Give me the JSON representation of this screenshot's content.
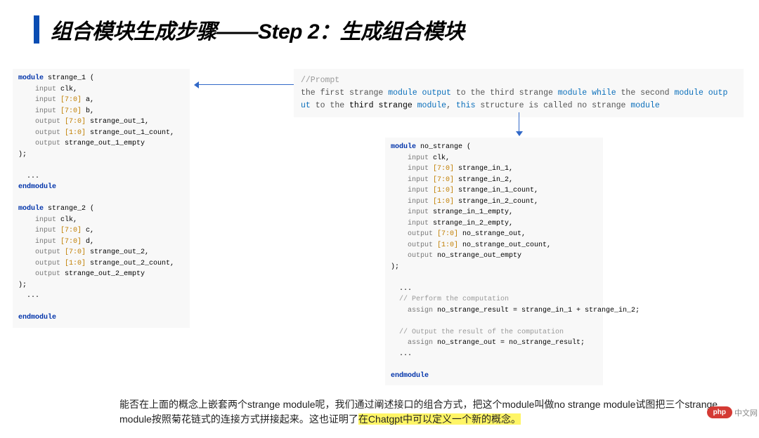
{
  "title": "组合模块生成步骤——Step 2：生成组合模块",
  "left_code": {
    "l1a": "module",
    "l1b": " strange_1 (",
    "l2a": "    input",
    "l2b": " clk,",
    "l3a": "    input ",
    "l3b": "[7:0]",
    "l3c": " a,",
    "l4a": "    input ",
    "l4b": "[7:0]",
    "l4c": " b,",
    "l5a": "    output ",
    "l5b": "[7:0]",
    "l5c": " strange_out_1,",
    "l6a": "    output ",
    "l6b": "[1:0]",
    "l6c": " strange_out_1_count,",
    "l7a": "    output",
    "l7b": " strange_out_1_empty",
    "l8": ");",
    "l9": " ",
    "l10": "  ...",
    "l11": "endmodule",
    "l12": " ",
    "l13a": "module",
    "l13b": " strange_2 (",
    "l14a": "    input",
    "l14b": " clk,",
    "l15a": "    input ",
    "l15b": "[7:0]",
    "l15c": " c,",
    "l16a": "    input ",
    "l16b": "[7:0]",
    "l16c": " d,",
    "l17a": "    output ",
    "l17b": "[7:0]",
    "l17c": " strange_out_2,",
    "l18a": "    output ",
    "l18b": "[1:0]",
    "l18c": " strange_out_2_count,",
    "l19a": "    output",
    "l19b": " strange_out_2_empty",
    "l20": ");",
    "l21": "  ...",
    "l22": " ",
    "l23": "endmodule"
  },
  "prompt": {
    "c": "//Prompt",
    "p1a": "the first strange ",
    "p1b": "module output",
    "p1c": " to the third strange ",
    "p1d": "module while",
    "p1e": " the second ",
    "p1f": "module outp",
    "p2a": "ut",
    "p2b": " to the ",
    "p2c": "third strange",
    "p2d": " module",
    "p2e": ", ",
    "p2f": "this",
    "p2g": " structure is called no strange ",
    "p2h": "module"
  },
  "right_code": {
    "l1a": "module",
    "l1b": " no_strange (",
    "l2a": "    input",
    "l2b": " clk,",
    "l3a": "    input ",
    "l3b": "[7:0]",
    "l3c": " strange_in_1,",
    "l4a": "    input ",
    "l4b": "[7:0]",
    "l4c": " strange_in_2,",
    "l5a": "    input ",
    "l5b": "[1:0]",
    "l5c": " strange_in_1_count,",
    "l6a": "    input ",
    "l6b": "[1:0]",
    "l6c": " strange_in_2_count,",
    "l7a": "    input",
    "l7b": " strange_in_1_empty,",
    "l8a": "    input",
    "l8b": " strange_in_2_empty,",
    "l9a": "    output ",
    "l9b": "[7:0]",
    "l9c": " no_strange_out,",
    "l10a": "    output ",
    "l10b": "[1:0]",
    "l10c": " no_strange_out_count,",
    "l11a": "    output",
    "l11b": " no_strange_out_empty",
    "l12": ");",
    "l13": " ",
    "l14": "  ...",
    "l15": "  // Perform the computation",
    "l16a": "    assign",
    "l16b": " no_strange_result = strange_in_1 + strange_in_2;",
    "l17": " ",
    "l18": "  // Output the result of the computation",
    "l19a": "    assign",
    "l19b": " no_strange_out = no_strange_result;",
    "l20": "  ...",
    "l21": " ",
    "l22": "endmodule"
  },
  "paragraph": {
    "p1": "能否在上面的概念上嵌套两个strange module呢，我们通过阐述接口的组合方式，把这个module叫做no strange module试图把三个strange module按照菊花链式的连接方式拼接起来。这也证明了",
    "hl": "在Chatgpt中可以定义一个新的概念。"
  },
  "logo": {
    "badge": "php",
    "text": "中文网"
  }
}
